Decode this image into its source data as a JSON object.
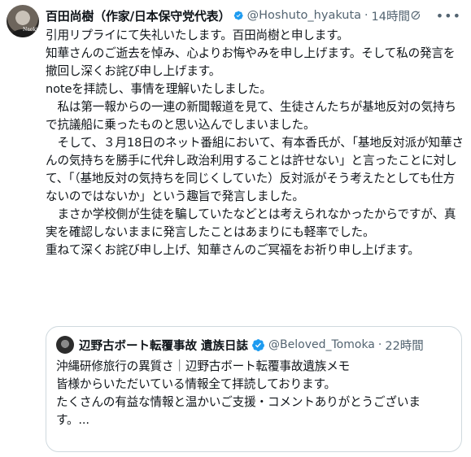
{
  "post": {
    "author_name": "百田尚樹（作家/日本保守党代表）",
    "handle": "@Hoshuto_hyakuta",
    "separator": "·",
    "time": "14時間",
    "verified_color": "#1d9bf0",
    "avatar_sign": "Naoki",
    "paragraphs": [
      "引用リプライにて失礼いたします。百田尚樹と申します。",
      "",
      "知華さんのご逝去を悼み、心よりお悔やみを申し上げます。そして私の発言を撤回し深くお詫び申し上げます。",
      "",
      "noteを拝読し、事情を理解いたしました。",
      "　私は第一報からの一連の新聞報道を見て、生徒さんたちが基地反対の気持ちで抗議船に乗ったものと思い込んでしまいました。",
      "　そして、３月18日のネット番組において、有本香氏が、「基地反対派が知華さんの気持ちを勝手に代弁し政治利用することは許せない」と言ったことに対して、「（基地反対の気持ちを同じくしていた）反対派がそう考えたとしても仕方ないのではないか」という趣旨で発言しました。",
      "",
      "　まさか学校側が生徒を騙していたなどとは考えられなかったからですが、真実を確認しないままに発言したことはあまりにも軽率でした。",
      "",
      "重ねて深くお詫び申し上げ、知華さんのご冥福をお祈り申し上げます。"
    ]
  },
  "quoted_post": {
    "author_name": "辺野古ボート転覆事故 遺族日誌",
    "handle": "@Beloved_Tomoka",
    "separator": "·",
    "time": "22時間",
    "paragraphs": [
      "沖縄研修旅行の異質さ｜辺野古ボート転覆事故遺族メモ",
      "",
      "皆様からいただいている情報全て拝読しております。",
      "たくさんの有益な情報と温かいご支援・コメントありがとうございます。..."
    ]
  },
  "icons": {
    "verified": "verified-badge-icon",
    "grok": "grok-icon",
    "more": "more-icon"
  }
}
